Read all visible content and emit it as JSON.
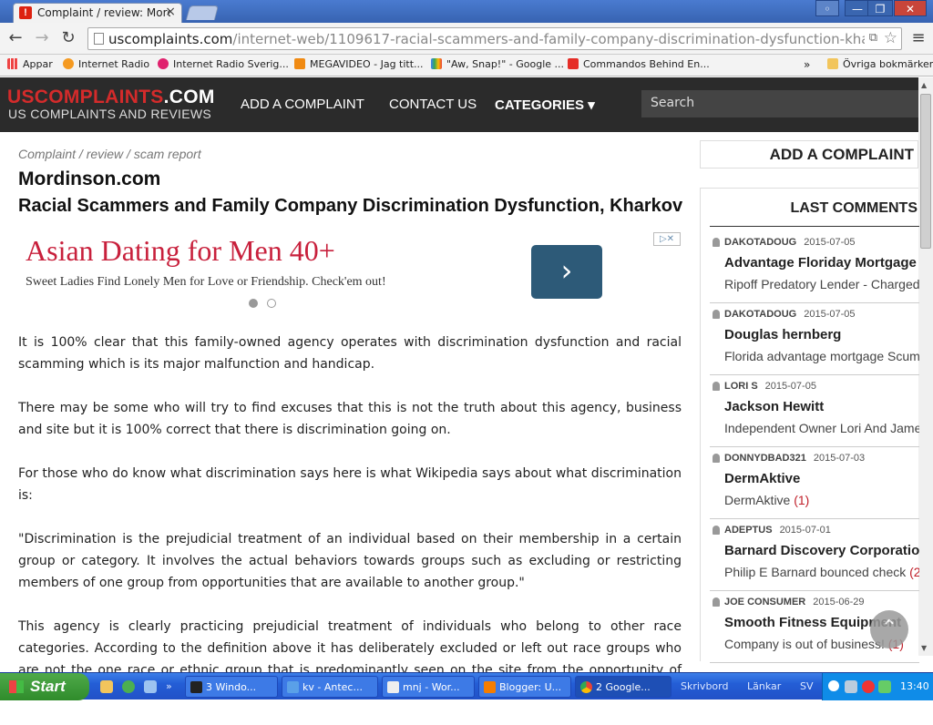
{
  "browser": {
    "tab_title": "Complaint / review: Mordinsc",
    "url_domain": "uscomplaints.com",
    "url_path": "/internet-web/1109617-racial-scammers-and-family-company-discrimination-dysfunction-kharkov.h",
    "bookmarks": [
      "Appar",
      "Internet Radio",
      "Internet Radio Sverig...",
      "MEGAVIDEO - Jag titt...",
      "\"Aw, Snap!\" - Google ...",
      "Commandos Behind En...",
      "Övriga bokmärken"
    ],
    "more": "»"
  },
  "site": {
    "logo_red": "USCOMPLAINTS",
    "logo_white": ".COM",
    "tagline": "US COMPLAINTS AND REVIEWS",
    "nav": [
      "ADD A COMPLAINT",
      "CONTACT US",
      "CATEGORIES ▾"
    ],
    "search_placeholder": "Search"
  },
  "main": {
    "crumb": "Complaint / review / scam report",
    "site_name": "Mordinson.com",
    "headline": "Racial Scammers and Family Company Discrimination Dysfunction, Kharkov",
    "ad": {
      "title": "Asian Dating for Men 40+",
      "subtitle": "Sweet Ladies Find Lonely Men for Love or Friendship. Check'em out!",
      "button": "›",
      "close": "▷✕"
    },
    "paragraphs": [
      "It is 100% clear that this family-owned agency operates with discrimination dysfunction and racial scamming which is its major malfunction and handicap.",
      "There may be some who will try to find excuses that this is not the truth about this agency, business and site but it is 100% correct that there is discrimination going on.",
      "For those who do know what discrimination says here is what Wikipedia says about what discrimination is:",
      "\"Discrimination is the prejudicial treatment of an individual based on their membership in a certain group or category. It involves the actual behaviors towards groups such as excluding or restricting members of one group from opportunities that are available to another group.\"",
      "This agency is clearly practicing prejudicial treatment of individuals who belong to other race categories. According to the definition above it has deliberately excluded or left out race groups who are not the one race or ethnic group that is predominantly seen on the site from the opportunity of being visibly"
    ]
  },
  "sidebar": {
    "add_label": "ADD A COMPLAINT",
    "last_comments_title": "LAST COMMENTS",
    "comments": [
      {
        "user": "DAKOTADOUG",
        "date": "2015-07-05",
        "title": "Advantage Floriday Mortgage - Do",
        "text": "Ripoff Predatory Lender - Charged",
        "count": ""
      },
      {
        "user": "DAKOTADOUG",
        "date": "2015-07-05",
        "title": "Douglas hernberg",
        "text": "Florida advantage mortgage Scum",
        "count": ""
      },
      {
        "user": "LORI S",
        "date": "2015-07-05",
        "title": "Jackson Hewitt",
        "text": "Independent Owner Lori And Jame",
        "count": ""
      },
      {
        "user": "DONNYDBAD321",
        "date": "2015-07-03",
        "title": "DermAktive",
        "text": "DermAktive ",
        "count": "(1)"
      },
      {
        "user": "ADEPTUS",
        "date": "2015-07-01",
        "title": "Barnard Discovery Corporation",
        "text": "Philip E Barnard bounced check ",
        "count": "(2)"
      },
      {
        "user": "JOE CONSUMER",
        "date": "2015-06-29",
        "title": "Smooth Fitness Equipment",
        "text": "Company is out of business! ",
        "count": "(1)"
      }
    ]
  },
  "taskbar": {
    "start": "Start",
    "items": [
      "3 Windo...",
      "kv - Antec...",
      "mnj - Wor...",
      "Blogger: U...",
      "2 Google..."
    ],
    "toolbars": [
      "Skrivbord",
      "Länkar",
      "SV"
    ],
    "clock": "13:40"
  },
  "colors": {
    "accent_red": "#d42b2b",
    "header_bg": "#2b2b2b",
    "ad_title": "#c8203c",
    "ad_button": "#2d5a78"
  }
}
